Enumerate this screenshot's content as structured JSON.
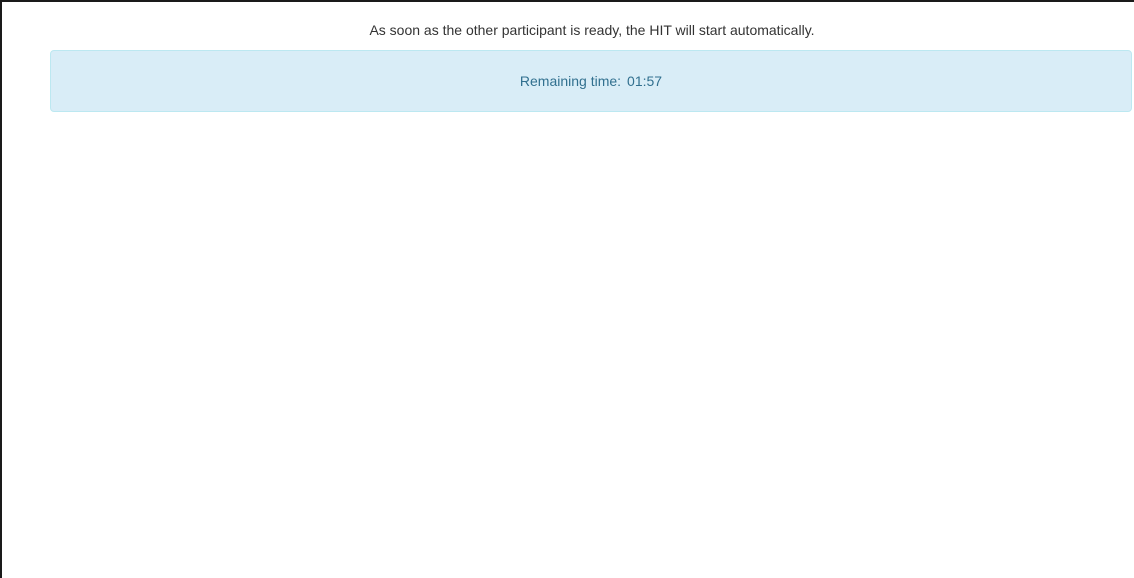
{
  "waiting": {
    "message": "As soon as the other participant is ready, the HIT will start automatically."
  },
  "timer": {
    "label": "Remaining time:",
    "value": "01:57"
  },
  "colors": {
    "alert_background": "#d9edf7",
    "alert_border": "#bce8f1",
    "alert_text": "#31708f",
    "body_text": "#333333"
  }
}
